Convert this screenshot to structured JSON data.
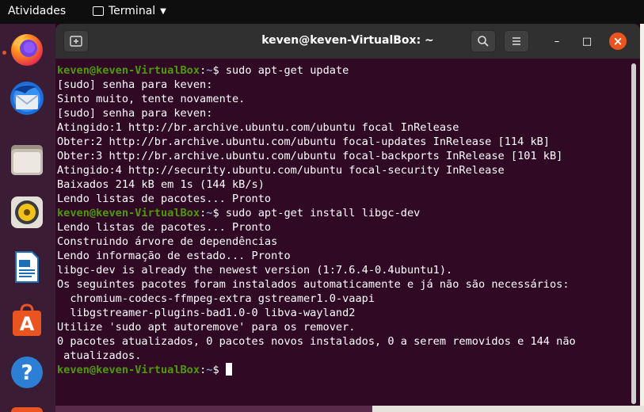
{
  "topbar": {
    "activities": "Atividades",
    "app_name": "Terminal",
    "app_icon": "terminal-icon",
    "caret_icon": "caret-down-icon"
  },
  "dock": {
    "items": [
      {
        "name": "firefox",
        "icon": "firefox-icon",
        "running": true
      },
      {
        "name": "thunderbird",
        "icon": "thunderbird-icon",
        "running": false
      },
      {
        "name": "files",
        "icon": "files-icon",
        "running": false
      },
      {
        "name": "rhythmbox",
        "icon": "rhythmbox-icon",
        "running": false
      },
      {
        "name": "libreoffice-writer",
        "icon": "writer-icon",
        "running": false
      },
      {
        "name": "software",
        "icon": "software-icon",
        "running": false
      },
      {
        "name": "help",
        "icon": "help-icon",
        "running": false
      }
    ]
  },
  "window": {
    "title": "keven@keven-VirtualBox: ~",
    "new_tab_icon": "new-tab-icon",
    "search_icon": "search-icon",
    "menu_icon": "hamburger-menu-icon",
    "minimize_glyph": "–",
    "maximize_glyph": "□",
    "close_glyph": "×"
  },
  "prompt": {
    "user": "keven@keven-VirtualBox",
    "sep": ":",
    "path": "~",
    "dollar": "$ "
  },
  "terminal": {
    "lines": [
      {
        "type": "prompt",
        "cmd": "sudo apt-get update"
      },
      {
        "type": "out",
        "text": "[sudo] senha para keven:"
      },
      {
        "type": "out",
        "text": "Sinto muito, tente novamente."
      },
      {
        "type": "out",
        "text": "[sudo] senha para keven:"
      },
      {
        "type": "out",
        "text": "Atingido:1 http://br.archive.ubuntu.com/ubuntu focal InRelease"
      },
      {
        "type": "out",
        "text": "Obter:2 http://br.archive.ubuntu.com/ubuntu focal-updates InRelease [114 kB]"
      },
      {
        "type": "out",
        "text": "Obter:3 http://br.archive.ubuntu.com/ubuntu focal-backports InRelease [101 kB]"
      },
      {
        "type": "out",
        "text": "Atingido:4 http://security.ubuntu.com/ubuntu focal-security InRelease"
      },
      {
        "type": "out",
        "text": "Baixados 214 kB em 1s (144 kB/s)"
      },
      {
        "type": "out",
        "text": "Lendo listas de pacotes... Pronto"
      },
      {
        "type": "prompt",
        "cmd": "sudo apt-get install libgc-dev"
      },
      {
        "type": "out",
        "text": "Lendo listas de pacotes... Pronto"
      },
      {
        "type": "out",
        "text": "Construindo árvore de dependências"
      },
      {
        "type": "out",
        "text": "Lendo informação de estado... Pronto"
      },
      {
        "type": "out",
        "text": "libgc-dev is already the newest version (1:7.6.4-0.4ubuntu1)."
      },
      {
        "type": "out",
        "text": "Os seguintes pacotes foram instalados automaticamente e já não são necessários:"
      },
      {
        "type": "out",
        "text": "  chromium-codecs-ffmpeg-extra gstreamer1.0-vaapi"
      },
      {
        "type": "out",
        "text": "  libgstreamer-plugins-bad1.0-0 libva-wayland2"
      },
      {
        "type": "out",
        "text": "Utilize 'sudo apt autoremove' para os remover."
      },
      {
        "type": "out",
        "text": "0 pacotes atualizados, 0 pacotes novos instalados, 0 a serem removidos e 144 não"
      },
      {
        "type": "out",
        "text": " atualizados."
      },
      {
        "type": "prompt",
        "cmd": "",
        "cursor": true
      }
    ]
  },
  "colors": {
    "terminal_bg": "#300a24",
    "prompt_user": "#4e9a06",
    "prompt_path": "#729fcf",
    "accent": "#e95420"
  }
}
